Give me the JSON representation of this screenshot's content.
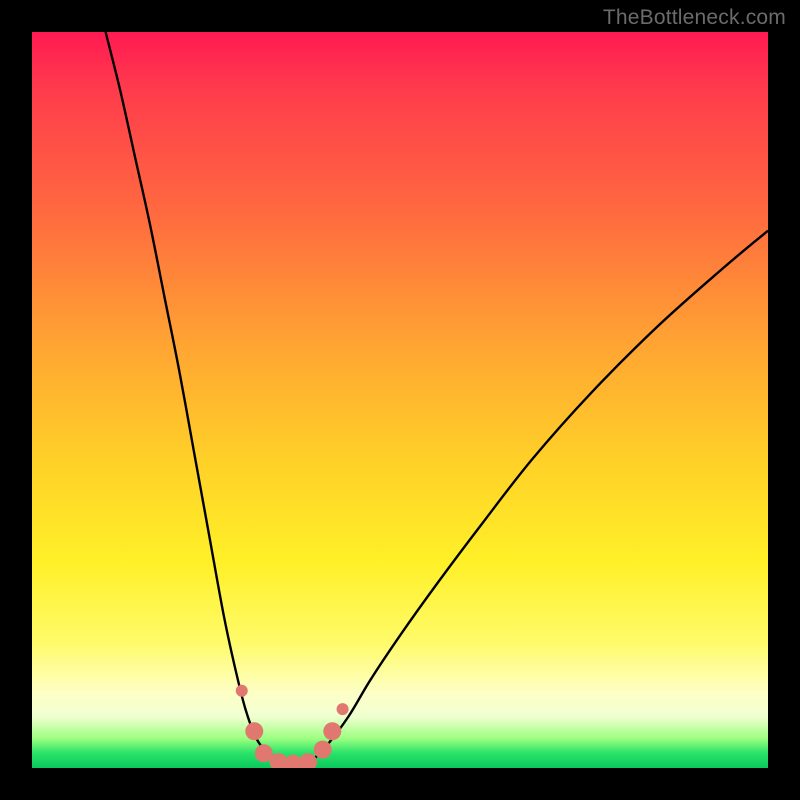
{
  "watermark": {
    "text": "TheBottleneck.com"
  },
  "chart_data": {
    "type": "line",
    "title": "",
    "xlabel": "",
    "ylabel": "",
    "ylim": [
      0,
      100
    ],
    "xlim": [
      0,
      100
    ],
    "series": [
      {
        "name": "left-branch",
        "x": [
          10,
          12,
          14,
          16,
          18,
          20,
          22,
          24,
          26,
          27.5,
          29,
          30.5,
          32,
          33,
          34
        ],
        "values": [
          100,
          92,
          83,
          74,
          64,
          54,
          43,
          32,
          21,
          14,
          8,
          4,
          2,
          1,
          0.5
        ]
      },
      {
        "name": "right-branch",
        "x": [
          37,
          38,
          40,
          43,
          46,
          50,
          55,
          61,
          68,
          76,
          85,
          94,
          100
        ],
        "values": [
          0.5,
          1,
          3,
          7,
          12,
          18,
          25,
          33,
          42,
          51,
          60,
          68,
          73
        ]
      },
      {
        "name": "floor",
        "x": [
          34,
          35.5,
          37
        ],
        "values": [
          0.5,
          0.5,
          0.5
        ]
      }
    ],
    "markers": {
      "name": "highlight-points",
      "color": "#e0786f",
      "points": [
        {
          "x": 28.5,
          "y": 10.5
        },
        {
          "x": 30.2,
          "y": 5
        },
        {
          "x": 31.5,
          "y": 2
        },
        {
          "x": 33.5,
          "y": 0.8
        },
        {
          "x": 35.5,
          "y": 0.6
        },
        {
          "x": 37.5,
          "y": 0.8
        },
        {
          "x": 39.5,
          "y": 2.5
        },
        {
          "x": 40.8,
          "y": 5
        },
        {
          "x": 42.2,
          "y": 8
        }
      ]
    },
    "background": {
      "type": "vertical-gradient",
      "stops": [
        {
          "pct": 0,
          "color": "#ff1a52"
        },
        {
          "pct": 25,
          "color": "#ff6b3f"
        },
        {
          "pct": 58,
          "color": "#ffd028"
        },
        {
          "pct": 90,
          "color": "#fdffc8"
        },
        {
          "pct": 100,
          "color": "#0cc95e"
        }
      ]
    }
  }
}
